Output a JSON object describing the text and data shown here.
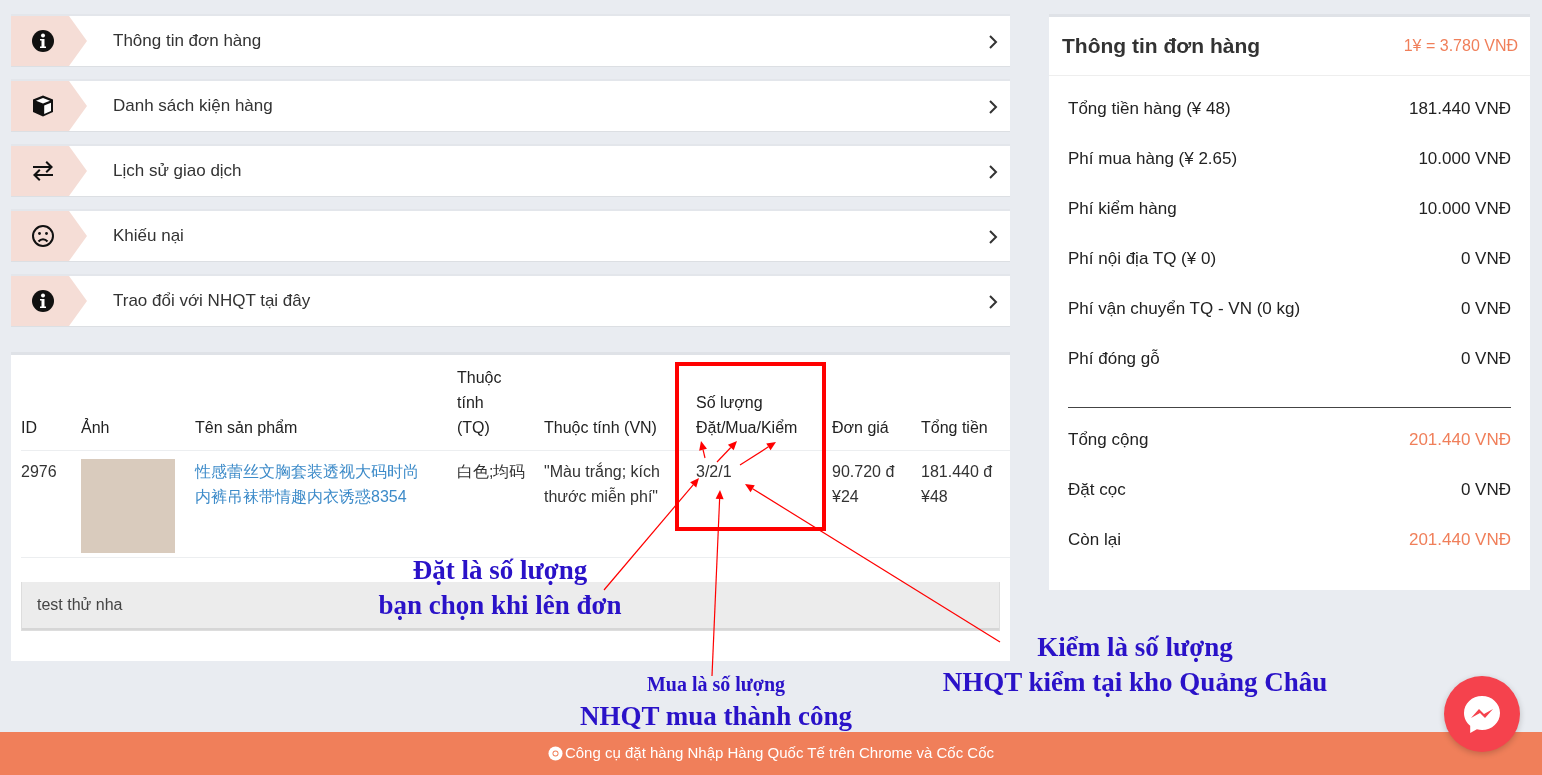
{
  "menu": [
    {
      "kind": "info",
      "label": "Thông tin đơn hàng"
    },
    {
      "kind": "package",
      "label": "Danh sách kiện hàng"
    },
    {
      "kind": "history",
      "label": "Lịch sử giao dịch"
    },
    {
      "kind": "complaint",
      "label": "Khiếu nại"
    },
    {
      "kind": "info",
      "label": "Trao đổi với NHQT tại đây"
    }
  ],
  "table": {
    "columns": [
      "ID",
      "Ảnh",
      "Tên sản phẩm",
      "Thuộc tính (TQ)",
      "Thuộc tính (VN)",
      "Số lượng Đặt/Mua/Kiểm",
      "Đơn giá",
      "Tổng tiền"
    ],
    "rows": [
      {
        "id": "2976",
        "product_name": "性感蕾丝文胸套装透视大码时尚内裤吊袜带情趣内衣诱惑8354",
        "attr_tq": "白色;均码",
        "attr_vn": "\"Màu trắng; kích thước miễn phí\"",
        "quantity": "3/2/1",
        "unit_price": [
          "90.720 đ",
          "¥24"
        ],
        "total": [
          "181.440 đ",
          "¥48"
        ]
      }
    ],
    "note": "test thử nha"
  },
  "summary": {
    "title": "Thông tin đơn hàng",
    "rate": "1¥ = 3.780 VNĐ",
    "groups": [
      [
        {
          "label": "Tổng tiền hàng (¥ 48)",
          "value": "181.440 VNĐ",
          "highlight": false
        },
        {
          "label": "Phí mua hàng (¥ 2.65)",
          "value": "10.000 VNĐ",
          "highlight": false
        },
        {
          "label": "Phí kiểm hàng",
          "value": "10.000 VNĐ",
          "highlight": false
        },
        {
          "label": "Phí nội địa TQ (¥ 0)",
          "value": "0 VNĐ",
          "highlight": false
        },
        {
          "label": "Phí vận chuyển TQ - VN (0 kg)",
          "value": "0 VNĐ",
          "highlight": false
        },
        {
          "label": "Phí đóng gỗ",
          "value": "0 VNĐ",
          "highlight": false
        }
      ],
      [
        {
          "label": "Tổng cộng",
          "value": "201.440 VNĐ",
          "highlight": true
        },
        {
          "label": "Đặt cọc",
          "value": "0 VNĐ",
          "highlight": false
        },
        {
          "label": "Còn lại",
          "value": "201.440 VNĐ",
          "highlight": true
        }
      ]
    ]
  },
  "annotations": [
    {
      "lines": [
        {
          "text": "Đặt là số lượng",
          "kind": "large"
        },
        {
          "text": "bạn chọn khi lên đơn",
          "kind": "large"
        }
      ]
    },
    {
      "lines": [
        {
          "text": "Mua là số lượng",
          "kind": "small"
        },
        {
          "text": "NHQT mua thành công",
          "kind": "large"
        }
      ]
    },
    {
      "lines": [
        {
          "text": "Kiểm là số lượng",
          "kind": "large"
        },
        {
          "text": "NHQT kiểm tại kho Quảng Châu",
          "kind": "large"
        }
      ]
    }
  ],
  "footer": {
    "text": "Công cụ đặt hàng Nhập Hàng Quốc Tế trên Chrome và Cốc Cốc"
  }
}
